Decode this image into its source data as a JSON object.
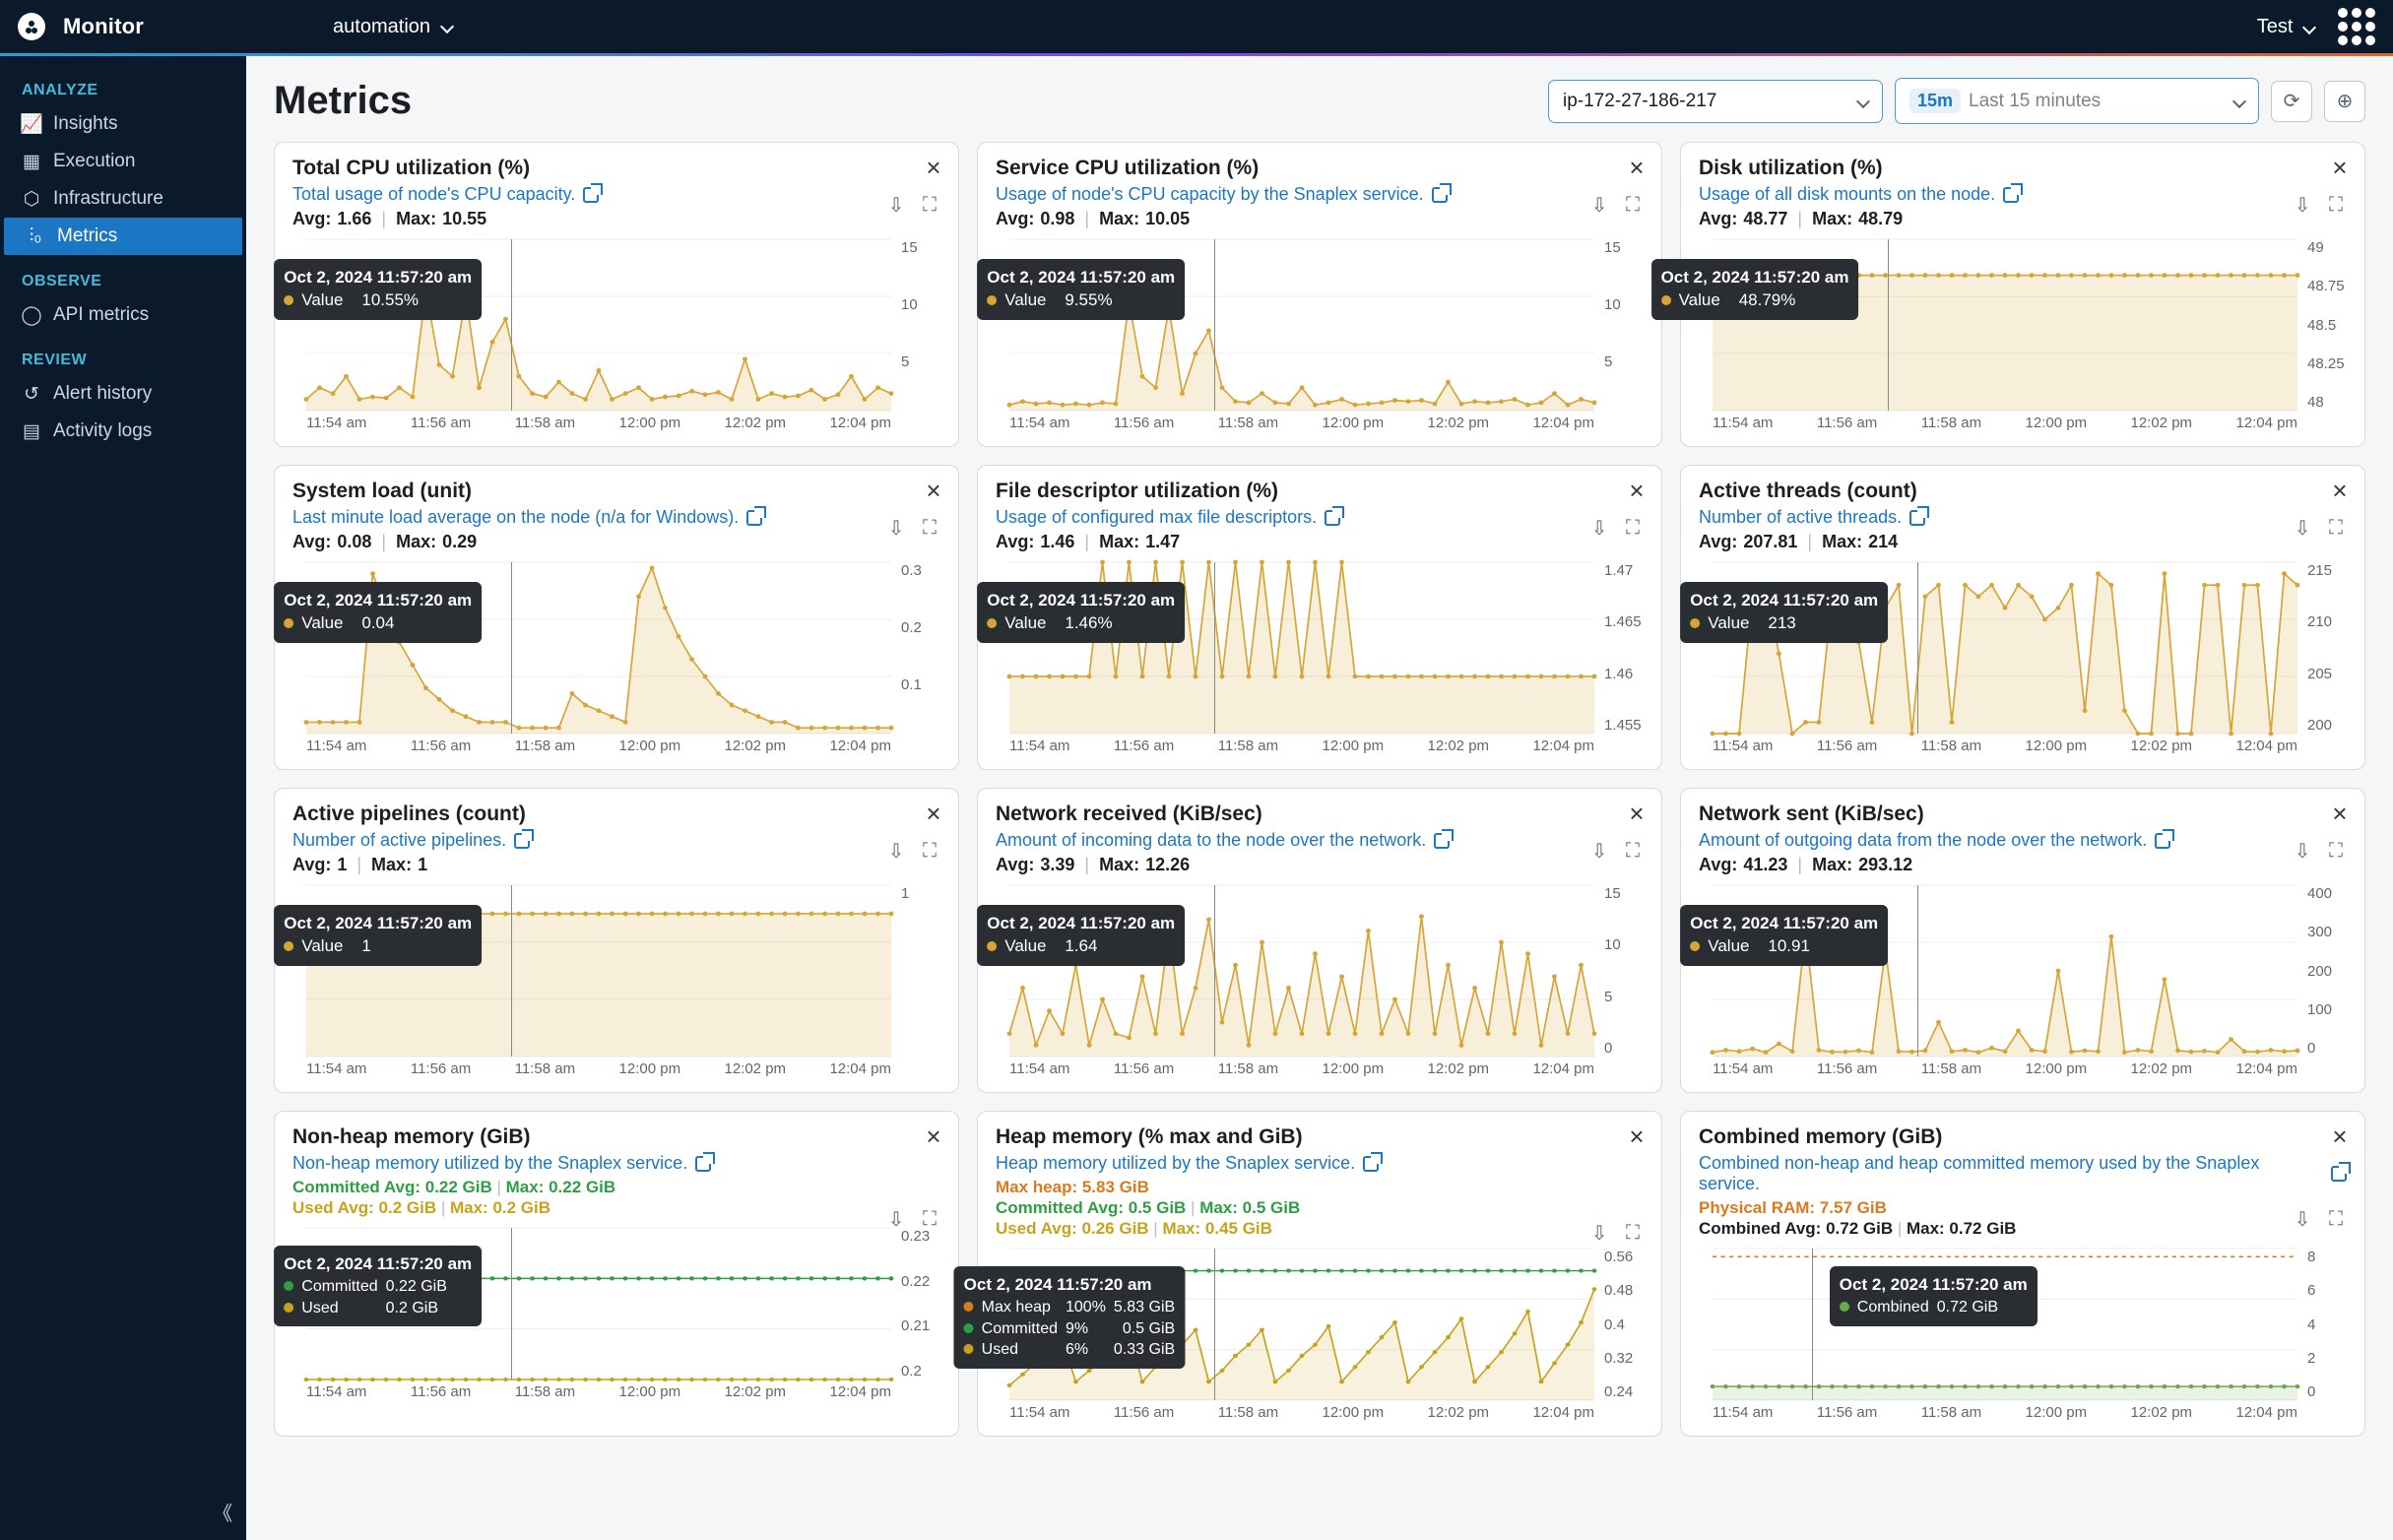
{
  "app_name": "Monitor",
  "workspace": "automation",
  "user": "Test",
  "sidebar": {
    "analyze_label": "ANALYZE",
    "observe_label": "OBSERVE",
    "review_label": "REVIEW",
    "items": {
      "insights": "Insights",
      "execution": "Execution",
      "infrastructure": "Infrastructure",
      "metrics": "Metrics",
      "api_metrics": "API metrics",
      "alert_history": "Alert history",
      "activity_logs": "Activity logs"
    }
  },
  "page_title": "Metrics",
  "filters": {
    "node": "ip-172-27-186-217",
    "time_badge": "15m",
    "time_label": "Last 15 minutes"
  },
  "xaxis_ticks": [
    "11:54 am",
    "11:56 am",
    "11:58 am",
    "12:00 pm",
    "12:02 pm",
    "12:04 pm"
  ],
  "tooltip_time": "Oct 2, 2024 11:57:20 am",
  "cards": [
    {
      "id": "cpu_total",
      "title": "Total CPU utilization (%)",
      "desc": "Total usage of node's CPU capacity.",
      "avg": "1.66",
      "max": "10.55",
      "yticks": [
        "15",
        "10",
        "5",
        ""
      ],
      "tooltip": {
        "value": "10.55%"
      },
      "crosshair_pct": 35
    },
    {
      "id": "cpu_service",
      "title": "Service CPU utilization (%)",
      "desc": "Usage of node's CPU capacity by the Snaplex service.",
      "avg": "0.98",
      "max": "10.05",
      "yticks": [
        "15",
        "10",
        "5",
        ""
      ],
      "tooltip": {
        "value": "9.55%"
      },
      "crosshair_pct": 35
    },
    {
      "id": "disk",
      "title": "Disk utilization (%)",
      "desc": "Usage of all disk mounts on the node.",
      "avg": "48.77",
      "max": "48.79",
      "yticks": [
        "49",
        "48.75",
        "48.5",
        "48.25",
        "48"
      ],
      "tooltip": {
        "value": "48.79%"
      },
      "crosshair_pct": 30
    },
    {
      "id": "sysload",
      "title": "System load (unit)",
      "desc": "Last minute load average on the node (n/a for Windows).",
      "avg": "0.08",
      "max": "0.29",
      "yticks": [
        "0.3",
        "0.2",
        "0.1",
        ""
      ],
      "tooltip": {
        "value": "0.04"
      },
      "crosshair_pct": 35
    },
    {
      "id": "fdutil",
      "title": "File descriptor utilization (%)",
      "desc": "Usage of configured max file descriptors.",
      "avg": "1.46",
      "max": "1.47",
      "yticks": [
        "1.47",
        "1.465",
        "1.46",
        "1.455"
      ],
      "tooltip": {
        "value": "1.46%"
      },
      "crosshair_pct": 35
    },
    {
      "id": "threads",
      "title": "Active threads (count)",
      "desc": "Number of active threads.",
      "avg": "207.81",
      "max": "214",
      "yticks": [
        "215",
        "210",
        "205",
        "200"
      ],
      "tooltip": {
        "value": "213"
      },
      "crosshair_pct": 35
    },
    {
      "id": "pipelines",
      "title": "Active pipelines (count)",
      "desc": "Number of active pipelines.",
      "avg": "1",
      "max": "1",
      "yticks": [
        "1"
      ],
      "tooltip": {
        "value": "1"
      },
      "crosshair_pct": 35
    },
    {
      "id": "net_rx",
      "title": "Network received (KiB/sec)",
      "desc": "Amount of incoming data to the node over the network.",
      "avg": "3.39",
      "max": "12.26",
      "yticks": [
        "15",
        "10",
        "5",
        "0"
      ],
      "tooltip": {
        "value": "1.64"
      },
      "crosshair_pct": 35
    },
    {
      "id": "net_tx",
      "title": "Network sent (KiB/sec)",
      "desc": "Amount of outgoing data from the node over the network.",
      "avg": "41.23",
      "max": "293.12",
      "yticks": [
        "400",
        "300",
        "200",
        "100",
        "0"
      ],
      "tooltip": {
        "value": "10.91"
      },
      "crosshair_pct": 35
    },
    {
      "id": "nonheap",
      "title": "Non-heap memory (GiB)",
      "desc": "Non-heap memory utilized by the Snaplex service.",
      "yticks": [
        "0.23",
        "0.22",
        "0.21",
        "0.2"
      ],
      "legend": [
        {
          "cls": "row-green",
          "text": "Committed Avg: 0.22 GiB",
          "sep": "|",
          "text2": "Max: 0.22 GiB"
        },
        {
          "cls": "row-yellow",
          "text": "Used Avg: 0.2 GiB",
          "sep": "|",
          "text2": "Max: 0.2 GiB"
        }
      ],
      "tooltip_rows": [
        {
          "color": "#2f9e44",
          "label": "Committed",
          "v1": "0.22 GiB"
        },
        {
          "color": "#c8a21a",
          "label": "Used",
          "v1": "0.2 GiB"
        }
      ],
      "crosshair_pct": 35
    },
    {
      "id": "heap",
      "title": "Heap memory (% max and GiB)",
      "desc": "Heap memory utilized by the Snaplex service.",
      "yticks": [
        "0.56",
        "0.48",
        "0.4",
        "0.32",
        "0.24"
      ],
      "legend": [
        {
          "cls": "row-orange",
          "text": "Max heap: 5.83 GiB"
        },
        {
          "cls": "row-green",
          "text": "Committed Avg: 0.5 GiB",
          "sep": "|",
          "text2": "Max: 0.5 GiB"
        },
        {
          "cls": "row-yellow",
          "text": "Used Avg: 0.26 GiB",
          "sep": "|",
          "text2": "Max: 0.45 GiB"
        }
      ],
      "tooltip_rows": [
        {
          "color": "#d87a1e",
          "label": "Max heap",
          "v1": "100%",
          "v2": "5.83 GiB"
        },
        {
          "color": "#2f9e44",
          "label": "Committed",
          "v1": "9%",
          "v2": "0.5 GiB"
        },
        {
          "color": "#c8a21a",
          "label": "Used",
          "v1": "6%",
          "v2": "0.33 GiB"
        }
      ],
      "crosshair_pct": 35
    },
    {
      "id": "combined",
      "title": "Combined memory (GiB)",
      "desc": "Combined non-heap and heap committed memory used by the Snaplex service.",
      "yticks": [
        "8",
        "6",
        "4",
        "2",
        "0"
      ],
      "legend": [
        {
          "cls": "row-orange",
          "text": "Physical RAM: 7.57 GiB"
        },
        {
          "cls": "",
          "text": "Combined Avg: 0.72 GiB",
          "sep": "|",
          "text2": "Max: 0.72 GiB"
        }
      ],
      "tooltip_rows": [
        {
          "color": "#6aa84f",
          "label": "Combined",
          "v1": "0.72 GiB"
        }
      ],
      "crosshair_pct": 17
    }
  ],
  "chart_data": {
    "xaxis": [
      "11:54 am",
      "11:56 am",
      "11:58 am",
      "12:00 pm",
      "12:02 pm",
      "12:04 pm"
    ],
    "cpu_total": {
      "type": "line",
      "ylim": [
        0,
        15
      ],
      "values": [
        1,
        2,
        1.5,
        3,
        1,
        1.2,
        1.1,
        2,
        1.2,
        10.55,
        4,
        3,
        10,
        2,
        6,
        8,
        3,
        1.5,
        1.2,
        2.5,
        1.5,
        1,
        3.5,
        1,
        1.5,
        2,
        1,
        1.2,
        1.3,
        1.7,
        1.4,
        1.6,
        1,
        4.5,
        1,
        1.5,
        1.2,
        1.3,
        1.8,
        1,
        1.4,
        3,
        1,
        2,
        1.5
      ]
    },
    "cpu_service": {
      "type": "line",
      "ylim": [
        0,
        15
      ],
      "values": [
        0.5,
        0.8,
        0.6,
        0.7,
        0.5,
        0.6,
        0.5,
        0.7,
        0.6,
        9.55,
        3,
        2,
        9,
        1.5,
        5,
        7,
        2,
        0.8,
        0.7,
        1.5,
        0.7,
        0.6,
        2,
        0.5,
        0.7,
        1,
        0.5,
        0.6,
        0.7,
        0.9,
        0.8,
        0.9,
        0.6,
        2.5,
        0.6,
        0.8,
        0.7,
        0.8,
        1,
        0.5,
        0.7,
        1.5,
        0.5,
        1,
        0.7
      ]
    },
    "disk": {
      "type": "line",
      "ylim": [
        48,
        49
      ],
      "values": [
        48.77,
        48.77,
        48.77,
        48.77,
        48.78,
        48.79,
        48.79,
        48.79,
        48.79,
        48.79,
        48.79,
        48.79,
        48.79,
        48.79,
        48.79,
        48.79,
        48.79,
        48.79,
        48.79,
        48.79,
        48.79,
        48.79,
        48.79,
        48.79,
        48.79,
        48.79,
        48.79,
        48.79,
        48.79,
        48.79,
        48.79,
        48.79,
        48.79,
        48.79,
        48.79,
        48.79,
        48.79,
        48.79,
        48.79,
        48.79,
        48.79,
        48.79,
        48.79,
        48.79,
        48.79
      ]
    },
    "sysload": {
      "type": "line",
      "ylim": [
        0,
        0.3
      ],
      "values": [
        0.02,
        0.02,
        0.02,
        0.02,
        0.02,
        0.28,
        0.22,
        0.16,
        0.12,
        0.08,
        0.06,
        0.04,
        0.03,
        0.02,
        0.02,
        0.02,
        0.01,
        0.01,
        0.01,
        0.01,
        0.07,
        0.05,
        0.04,
        0.03,
        0.02,
        0.24,
        0.29,
        0.22,
        0.17,
        0.13,
        0.1,
        0.07,
        0.05,
        0.04,
        0.03,
        0.02,
        0.02,
        0.01,
        0.01,
        0.01,
        0.01,
        0.01,
        0.01,
        0.01,
        0.01
      ]
    },
    "fdutil": {
      "type": "line",
      "ylim": [
        1.455,
        1.47
      ],
      "values": [
        1.46,
        1.46,
        1.46,
        1.46,
        1.46,
        1.46,
        1.46,
        1.47,
        1.46,
        1.47,
        1.46,
        1.47,
        1.46,
        1.47,
        1.46,
        1.47,
        1.46,
        1.47,
        1.46,
        1.47,
        1.46,
        1.47,
        1.46,
        1.47,
        1.46,
        1.47,
        1.46,
        1.46,
        1.46,
        1.46,
        1.46,
        1.46,
        1.46,
        1.46,
        1.46,
        1.46,
        1.46,
        1.46,
        1.46,
        1.46,
        1.46,
        1.46,
        1.46,
        1.46,
        1.46
      ]
    },
    "threads": {
      "type": "line",
      "ylim": [
        200,
        215
      ],
      "values": [
        200,
        200,
        200,
        212,
        213,
        207,
        200,
        201,
        201,
        212,
        213,
        208,
        201,
        211,
        213,
        200,
        212,
        213,
        201,
        213,
        212,
        213,
        211,
        213,
        212,
        210,
        211,
        213,
        202,
        214,
        213,
        202,
        200,
        200,
        214,
        200,
        200,
        213,
        213,
        200,
        213,
        213,
        200,
        214,
        213
      ]
    },
    "pipelines": {
      "type": "line",
      "ylim": [
        0,
        1.2
      ],
      "values": [
        1,
        1,
        1,
        1,
        1,
        1,
        1,
        1,
        1,
        1,
        1,
        1,
        1,
        1,
        1,
        1,
        1,
        1,
        1,
        1,
        1,
        1,
        1,
        1,
        1,
        1,
        1,
        1,
        1,
        1,
        1,
        1,
        1,
        1,
        1,
        1,
        1,
        1,
        1,
        1,
        1,
        1,
        1,
        1,
        1
      ]
    },
    "net_rx": {
      "type": "line",
      "ylim": [
        0,
        15
      ],
      "values": [
        2,
        6,
        1,
        4,
        2,
        8,
        1,
        5,
        2,
        1.64,
        7,
        2,
        11,
        2,
        6,
        12,
        3,
        8,
        1,
        10,
        2,
        6,
        2,
        9,
        2,
        7,
        2,
        11,
        2,
        5,
        2,
        12.26,
        2,
        8,
        1,
        6,
        2,
        10,
        2,
        9,
        1,
        7,
        2,
        8,
        2
      ]
    },
    "net_tx": {
      "type": "line",
      "ylim": [
        0,
        400
      ],
      "values": [
        10,
        15,
        12,
        18,
        10,
        30,
        12,
        293.12,
        15,
        10.91,
        11,
        14,
        10,
        250,
        12,
        11,
        14,
        80,
        12,
        15,
        10,
        20,
        12,
        60,
        15,
        12,
        200,
        11,
        14,
        12,
        280,
        10,
        15,
        12,
        180,
        14,
        11,
        13,
        10,
        40,
        12,
        11,
        15,
        12,
        14
      ]
    },
    "nonheap": {
      "type": "line",
      "ylim": [
        0.2,
        0.23
      ],
      "series": [
        {
          "name": "Committed",
          "color": "#2f9e44",
          "values": [
            0.22,
            0.22,
            0.22,
            0.22,
            0.22,
            0.22,
            0.22,
            0.22,
            0.22,
            0.22,
            0.22,
            0.22,
            0.22,
            0.22,
            0.22,
            0.22,
            0.22,
            0.22,
            0.22,
            0.22,
            0.22,
            0.22,
            0.22,
            0.22,
            0.22,
            0.22,
            0.22,
            0.22,
            0.22,
            0.22,
            0.22,
            0.22,
            0.22,
            0.22,
            0.22,
            0.22,
            0.22,
            0.22,
            0.22,
            0.22,
            0.22,
            0.22,
            0.22,
            0.22,
            0.22
          ]
        },
        {
          "name": "Used",
          "color": "#c8a21a",
          "values": [
            0.2,
            0.2,
            0.2,
            0.2,
            0.2,
            0.2,
            0.2,
            0.2,
            0.2,
            0.2,
            0.2,
            0.2,
            0.2,
            0.2,
            0.2,
            0.2,
            0.2,
            0.2,
            0.2,
            0.2,
            0.2,
            0.2,
            0.2,
            0.2,
            0.2,
            0.2,
            0.2,
            0.2,
            0.2,
            0.2,
            0.2,
            0.2,
            0.2,
            0.2,
            0.2,
            0.2,
            0.2,
            0.2,
            0.2,
            0.2,
            0.2,
            0.2,
            0.2,
            0.2,
            0.2
          ]
        }
      ]
    },
    "heap": {
      "type": "line",
      "ylim": [
        0.15,
        0.56
      ],
      "series": [
        {
          "name": "Committed",
          "color": "#2f9e44",
          "values": [
            0.5,
            0.5,
            0.5,
            0.5,
            0.5,
            0.5,
            0.5,
            0.5,
            0.5,
            0.5,
            0.5,
            0.5,
            0.5,
            0.5,
            0.5,
            0.5,
            0.5,
            0.5,
            0.5,
            0.5,
            0.5,
            0.5,
            0.5,
            0.5,
            0.5,
            0.5,
            0.5,
            0.5,
            0.5,
            0.5,
            0.5,
            0.5,
            0.5,
            0.5,
            0.5,
            0.5,
            0.5,
            0.5,
            0.5,
            0.5,
            0.5,
            0.5,
            0.5,
            0.5,
            0.5
          ]
        },
        {
          "name": "Used",
          "color": "#c8a21a",
          "values": [
            0.19,
            0.22,
            0.25,
            0.28,
            0.31,
            0.2,
            0.23,
            0.26,
            0.29,
            0.33,
            0.2,
            0.24,
            0.27,
            0.3,
            0.34,
            0.2,
            0.23,
            0.27,
            0.3,
            0.34,
            0.2,
            0.23,
            0.27,
            0.3,
            0.35,
            0.2,
            0.24,
            0.28,
            0.32,
            0.36,
            0.2,
            0.24,
            0.28,
            0.32,
            0.37,
            0.2,
            0.24,
            0.28,
            0.33,
            0.39,
            0.2,
            0.25,
            0.3,
            0.36,
            0.45
          ]
        }
      ]
    },
    "combined": {
      "type": "line",
      "ylim": [
        0,
        8
      ],
      "series": [
        {
          "name": "Physical",
          "color": "#d87a1e",
          "values": 7.57
        },
        {
          "name": "Combined",
          "color": "#6aa84f",
          "values": [
            0.72,
            0.72,
            0.72,
            0.72,
            0.72,
            0.72,
            0.72,
            0.72,
            0.72,
            0.72,
            0.72,
            0.72,
            0.72,
            0.72,
            0.72,
            0.72,
            0.72,
            0.72,
            0.72,
            0.72,
            0.72,
            0.72,
            0.72,
            0.72,
            0.72,
            0.72,
            0.72,
            0.72,
            0.72,
            0.72,
            0.72,
            0.72,
            0.72,
            0.72,
            0.72,
            0.72,
            0.72,
            0.72,
            0.72,
            0.72,
            0.72,
            0.72,
            0.72,
            0.72,
            0.72
          ]
        }
      ]
    }
  }
}
